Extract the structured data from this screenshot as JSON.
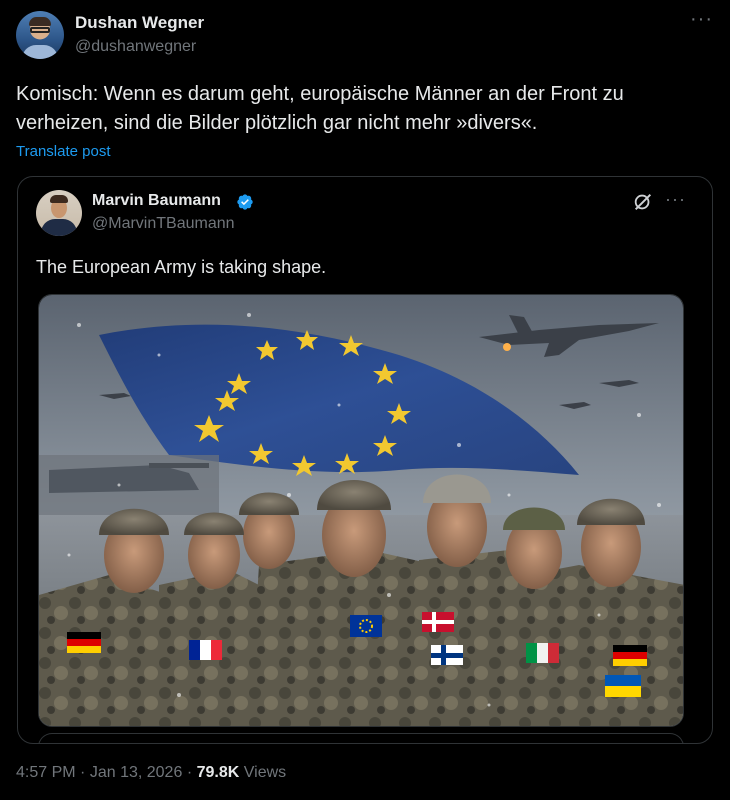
{
  "post": {
    "author_name": "Dushan Wegner",
    "author_handle": "@dushanwegner",
    "more_icon": "ellipsis-icon",
    "text_line1": "Komisch: Wenn es darum geht, europäische Männer an der Front zu",
    "text_line2": "verheizen, sind die Bilder plötzlich gar nicht mehr »divers«.",
    "translate_label": "Translate post"
  },
  "quote": {
    "author_name": "Marvin Baumann",
    "verified": true,
    "author_handle": "@MarvinTBaumann",
    "text": "The European Army is taking shape.",
    "image_description_icon": "image-soldiers-eu-flag",
    "grok_icon": "grok-icon",
    "more_icon": "ellipsis-icon"
  },
  "meta": {
    "time": "4:57 PM",
    "date": "Jan 13, 2026",
    "separator": "·",
    "views_count": "79.8K",
    "views_label": "Views"
  },
  "colors": {
    "background": "#000000",
    "text": "#e7e9ea",
    "secondary": "#71767b",
    "link": "#1d9bf0",
    "border": "#2f3336",
    "verified": "#1d9bf0"
  }
}
